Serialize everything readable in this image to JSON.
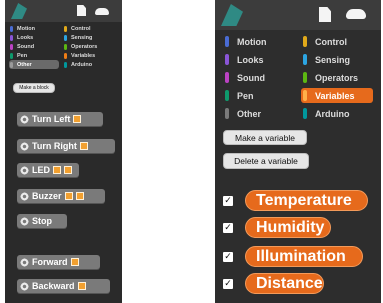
{
  "left_panel": {
    "categories": [
      {
        "label": "Motion",
        "color": "#4a6cd4",
        "selected": false
      },
      {
        "label": "Control",
        "color": "#e1a91a",
        "selected": false
      },
      {
        "label": "Looks",
        "color": "#8a55d7",
        "selected": false
      },
      {
        "label": "Sensing",
        "color": "#2ca5e2",
        "selected": false
      },
      {
        "label": "Sound",
        "color": "#bb42c3",
        "selected": false
      },
      {
        "label": "Operators",
        "color": "#5cb712",
        "selected": false
      },
      {
        "label": "Pen",
        "color": "#0e9a6c",
        "selected": false
      },
      {
        "label": "Variables",
        "color": "#ee7d16",
        "selected": false
      },
      {
        "label": "Other",
        "color": "#7a7a7a",
        "selected": true
      },
      {
        "label": "Arduino",
        "color": "#00979c",
        "selected": false
      }
    ],
    "make_block_label": "Make a block",
    "blocks": {
      "turn_left": "Turn Left",
      "turn_right": "Turn Right",
      "led": "LED",
      "buzzer": "Buzzer",
      "stop": "Stop",
      "forward": "Forward",
      "backward": "Backward"
    }
  },
  "right_panel": {
    "categories": [
      {
        "label": "Motion",
        "color": "#4a6cd4",
        "selected": false
      },
      {
        "label": "Control",
        "color": "#e1a91a",
        "selected": false
      },
      {
        "label": "Looks",
        "color": "#8a55d7",
        "selected": false
      },
      {
        "label": "Sensing",
        "color": "#2ca5e2",
        "selected": false
      },
      {
        "label": "Sound",
        "color": "#bb42c3",
        "selected": false
      },
      {
        "label": "Operators",
        "color": "#5cb712",
        "selected": false
      },
      {
        "label": "Pen",
        "color": "#0e9a6c",
        "selected": false
      },
      {
        "label": "Variables",
        "color": "#ee7d16",
        "selected": true
      },
      {
        "label": "Other",
        "color": "#7a7a7a",
        "selected": false
      },
      {
        "label": "Arduino",
        "color": "#00979c",
        "selected": false
      }
    ],
    "make_variable_label": "Make a variable",
    "delete_variable_label": "Delete a variable",
    "variables": {
      "temperature": "Temperature",
      "humidity": "Humidity",
      "illumination": "Illumination",
      "distance": "Distance"
    },
    "checkmark": "✓"
  },
  "colors": {
    "panel_bg": "#2b2b2b",
    "accent": "#e66a1c",
    "block_gray": "#7a7a7a",
    "slot_orange": "#f2a030"
  }
}
